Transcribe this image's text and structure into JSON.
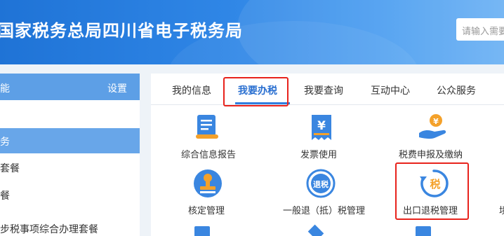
{
  "header": {
    "title": "国家税务总局四川省电子税务局",
    "search_placeholder": "请输入需要"
  },
  "left": {
    "head_left": "能",
    "head_right": "设置",
    "items": [
      {
        "label": "务"
      },
      {
        "label": "套餐"
      },
      {
        "label": "餐"
      },
      {
        "label": "步税事项综合办理套餐"
      }
    ]
  },
  "tabs": [
    {
      "label": "我的信息"
    },
    {
      "label": "我要办税"
    },
    {
      "label": "我要查询"
    },
    {
      "label": "互动中心"
    },
    {
      "label": "公众服务"
    }
  ],
  "apps": [
    {
      "label": "综合信息报告",
      "icon": "document-icon"
    },
    {
      "label": "发票使用",
      "icon": "invoice-icon"
    },
    {
      "label": "税费申报及缴纳",
      "icon": "hand-coin-icon"
    },
    {
      "label": "核定管理",
      "icon": "stamp-icon"
    },
    {
      "label": "一般退（抵）税管理",
      "icon": "refund-icon",
      "icon_text": "退税"
    },
    {
      "label": "出口退税管理",
      "icon": "export-refund-icon",
      "icon_text": "税"
    },
    {
      "label": "境",
      "icon": ""
    }
  ],
  "colors": {
    "header_start": "#1f73d6",
    "accent": "#2f7fe0",
    "highlight": "#e8231c",
    "icon_orange": "#f4a12a",
    "icon_blue": "#3a86e0"
  }
}
